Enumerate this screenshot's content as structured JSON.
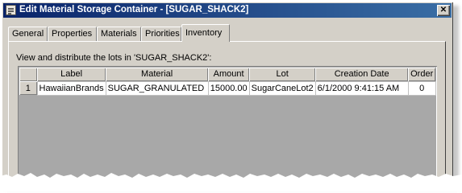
{
  "window": {
    "title": "Edit Material Storage Container - [SUGAR_SHACK2]",
    "close_glyph": "✕"
  },
  "tabs": [
    {
      "label": "General"
    },
    {
      "label": "Properties"
    },
    {
      "label": "Materials"
    },
    {
      "label": "Priorities"
    },
    {
      "label": "Inventory",
      "active": true
    }
  ],
  "inventory": {
    "instruction": "View and distribute the lots in 'SUGAR_SHACK2':",
    "columns": [
      "",
      "Label",
      "Material",
      "Amount",
      "Lot",
      "Creation Date",
      "Order"
    ],
    "rows": [
      {
        "row_number": "1",
        "label": "HawaiianBrands",
        "material": "SUGAR_GRANULATED",
        "amount": "15000.00",
        "lot": "SugarCaneLot2",
        "creation_date": "6/1/2000 9:41:15 AM",
        "order": "0"
      }
    ]
  },
  "colors": {
    "titlebar_start": "#0a246a",
    "titlebar_end": "#3a6ea5",
    "face": "#d4d0c8"
  },
  "icons": {
    "window_icon": "form-icon",
    "close": "close-icon"
  }
}
